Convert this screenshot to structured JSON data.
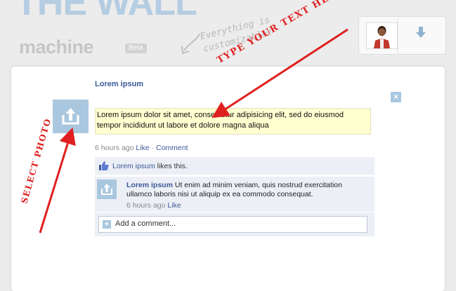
{
  "header": {
    "logo_top": "THE WALL",
    "logo_bottom": "machine",
    "beta_badge": "Beta",
    "note_line1": "Everything is",
    "note_line2": "customizable!"
  },
  "post": {
    "author": "Lorem ipsum",
    "text": "Lorem ipsum dolor sit amet, consectetur adipisicing elit, sed do eiusmod tempor incididunt ut labore et dolore magna aliqua",
    "time": "6 hours ago",
    "like_label": "Like",
    "separator": "·",
    "comment_label": "Comment",
    "close_label": "×"
  },
  "likes": {
    "name": "Lorem ipsum",
    "suffix": " likes this."
  },
  "comment": {
    "author": "Lorem ipsum",
    "text": " Ut enim ad minim veniam, quis nostrud exercitation ullamco laboris nisi ut aliquip ex ea commodo consequat.",
    "time": "6 hours ago",
    "like_label": "Like"
  },
  "add_comment": {
    "icon": "+",
    "placeholder": "Add a comment..."
  },
  "annotations": {
    "type_text": "TYPE YOUR TEXT HERE",
    "select_photo": "SELECT PHOTO"
  },
  "colors": {
    "link": "#3b5998",
    "photo_placeholder": "#a9c7df",
    "annotation_red": "#e02020",
    "text_highlight": "#ffffd0"
  }
}
